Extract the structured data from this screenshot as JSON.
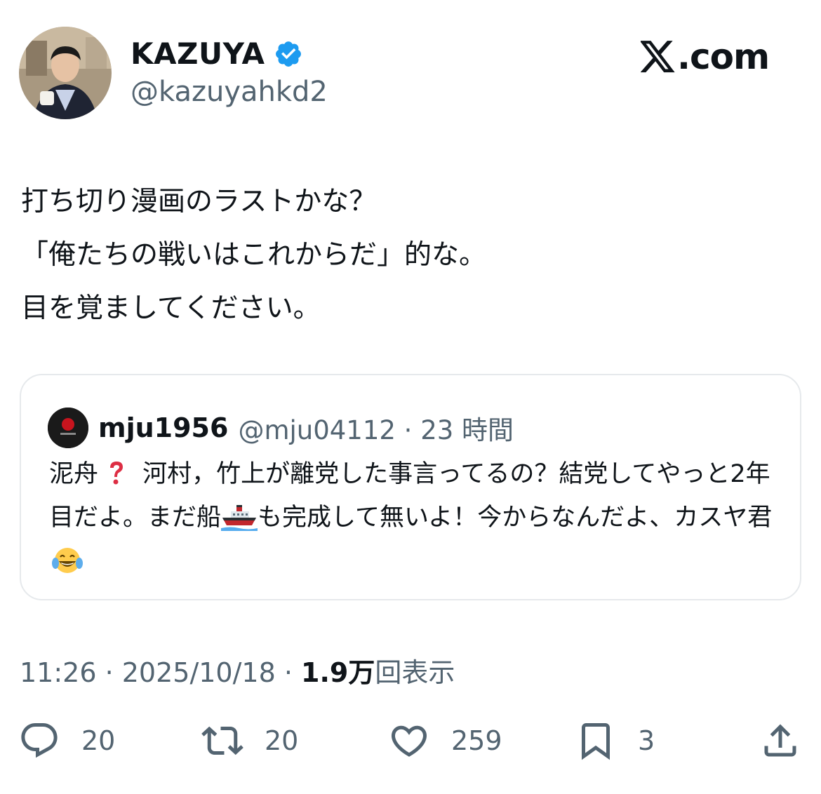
{
  "author": {
    "display_name": "KAZUYA",
    "handle": "@kazuyahkd2",
    "verified": true
  },
  "brand": {
    "logo_icon": "x-logo-icon",
    "domain_suffix": ".com"
  },
  "tweet": {
    "text": "打ち切り漫画のラストかな？\n「俺たちの戦いはこれからだ」的な。\n目を覚ましてください。"
  },
  "quote": {
    "display_name": "mju1956",
    "meta": "@mju04112 · 23 時間",
    "text_part1": "泥舟",
    "text_part2": "河村，竹上が離党した事言ってるの？結党してやっと2年目だよ。まだ船",
    "text_part3": "も完成して無いよ！今からなんだよ、カスヤ君",
    "emojis": [
      "red-question-mark-icon",
      "ship-icon",
      "tears-of-joy-icon"
    ]
  },
  "timestamp": {
    "time_date": "11:26 · 2025/10/18 · ",
    "views_count": "1.9万",
    "views_label": "回表示"
  },
  "actions": {
    "replies": "20",
    "reposts": "20",
    "likes": "259",
    "bookmarks": "3"
  },
  "colors": {
    "text_primary": "#0f1419",
    "text_secondary": "#536471",
    "verified_blue": "#1d9bf0",
    "card_border": "#e6e9ec"
  }
}
